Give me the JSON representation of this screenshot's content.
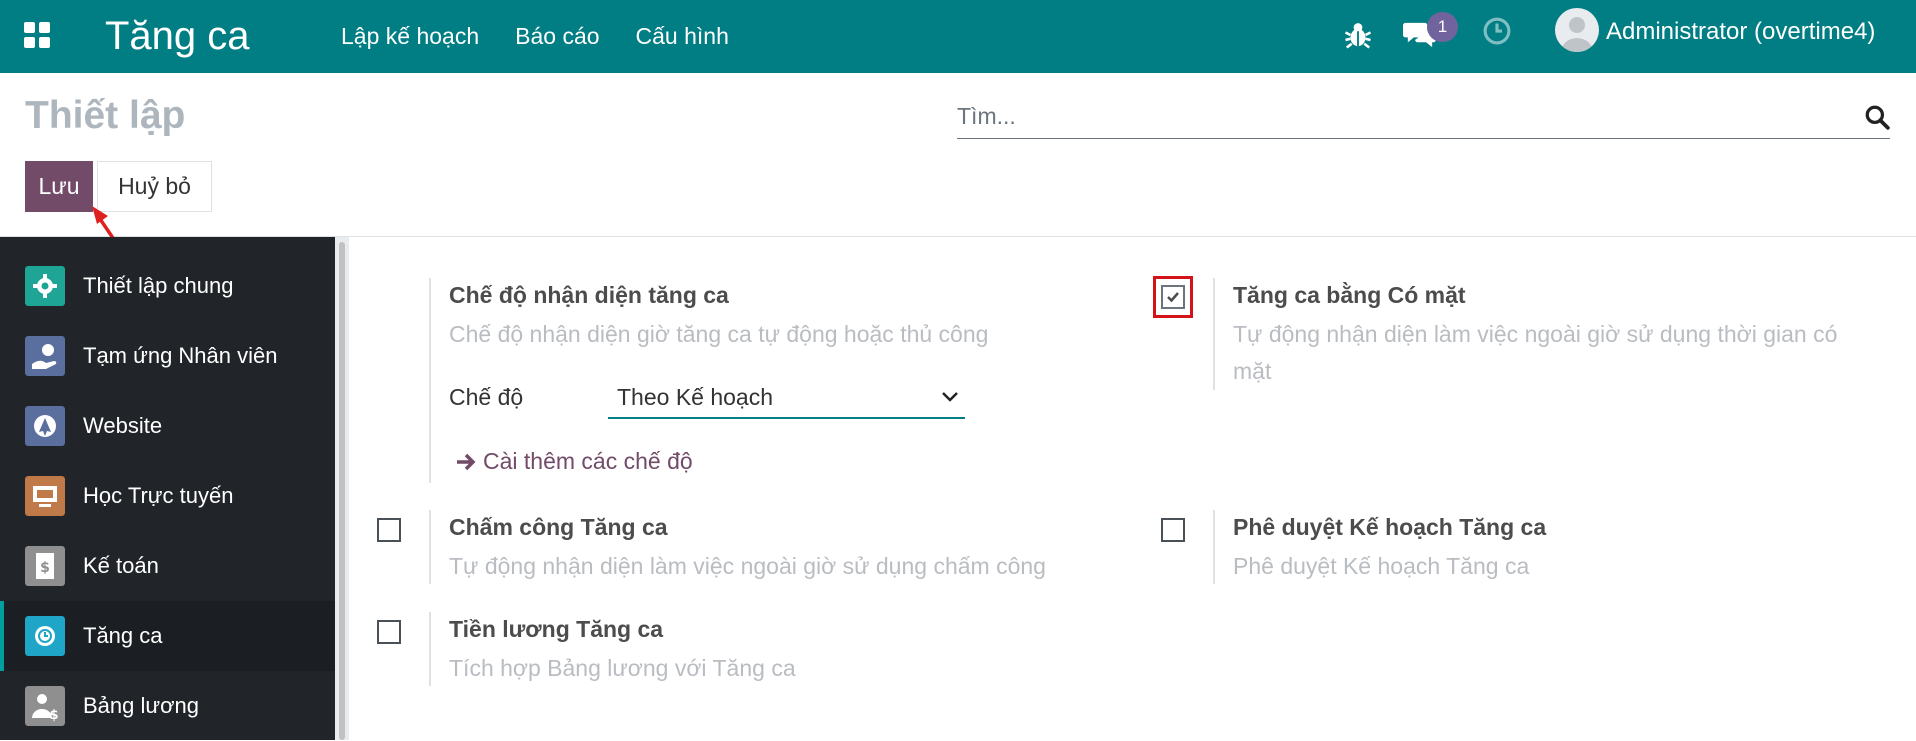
{
  "navbar": {
    "app_name": "Tăng ca",
    "menu": [
      "Lập kế hoạch",
      "Báo cáo",
      "Cấu hình"
    ],
    "message_badge": "1",
    "user": "Administrator (overtime4)"
  },
  "control_panel": {
    "title": "Thiết lập",
    "search_placeholder": "Tìm...",
    "save_label": "Lưu",
    "cancel_label": "Huỷ bỏ"
  },
  "sidebar": {
    "items": [
      {
        "label": "Thiết lập chung",
        "icon": "gear-icon",
        "color": "#1ea596"
      },
      {
        "label": "Tạm ứng Nhân viên",
        "icon": "advance-payment-icon",
        "color": "#5a6f9e"
      },
      {
        "label": "Website",
        "icon": "website-icon",
        "color": "#5a6f9e"
      },
      {
        "label": "Học Trực tuyến",
        "icon": "elearning-icon",
        "color": "#c07a4a"
      },
      {
        "label": "Kế toán",
        "icon": "accounting-icon",
        "color": "#8f8f8f"
      },
      {
        "label": "Tăng ca",
        "icon": "overtime-icon",
        "color": "#1ea5c7"
      },
      {
        "label": "Bảng lương",
        "icon": "payroll-icon",
        "color": "#8f8f8f"
      }
    ],
    "active": "Tăng ca"
  },
  "settings": {
    "mode": {
      "title": "Chế độ nhận diện tăng ca",
      "desc": "Chế độ nhận diện giờ tăng ca tự động hoặc thủ công",
      "field_label": "Chế độ",
      "field_value": "Theo Kế hoạch",
      "link": "Cài thêm các chế độ"
    },
    "presence": {
      "title": "Tăng ca bằng Có mặt",
      "desc_line1": "Tự động nhận diện làm việc ngoài giờ sử dụng thời gian có",
      "desc_line2": "mặt",
      "checked": true
    },
    "attendance": {
      "title": "Chấm công Tăng ca",
      "desc": "Tự động nhận diện làm việc ngoài giờ sử dụng chấm công",
      "checked": false
    },
    "approval": {
      "title": "Phê duyệt Kế hoạch Tăng ca",
      "desc": "Phê duyệt Kế hoạch Tăng ca",
      "checked": false
    },
    "payroll": {
      "title": "Tiền lương Tăng ca",
      "desc": "Tích hợp Bảng lương với Tăng ca",
      "checked": false
    }
  },
  "colors": {
    "navbar": "#017e84",
    "primary_button": "#714b67",
    "sidebar": "#212529",
    "highlight": "#d31318"
  }
}
